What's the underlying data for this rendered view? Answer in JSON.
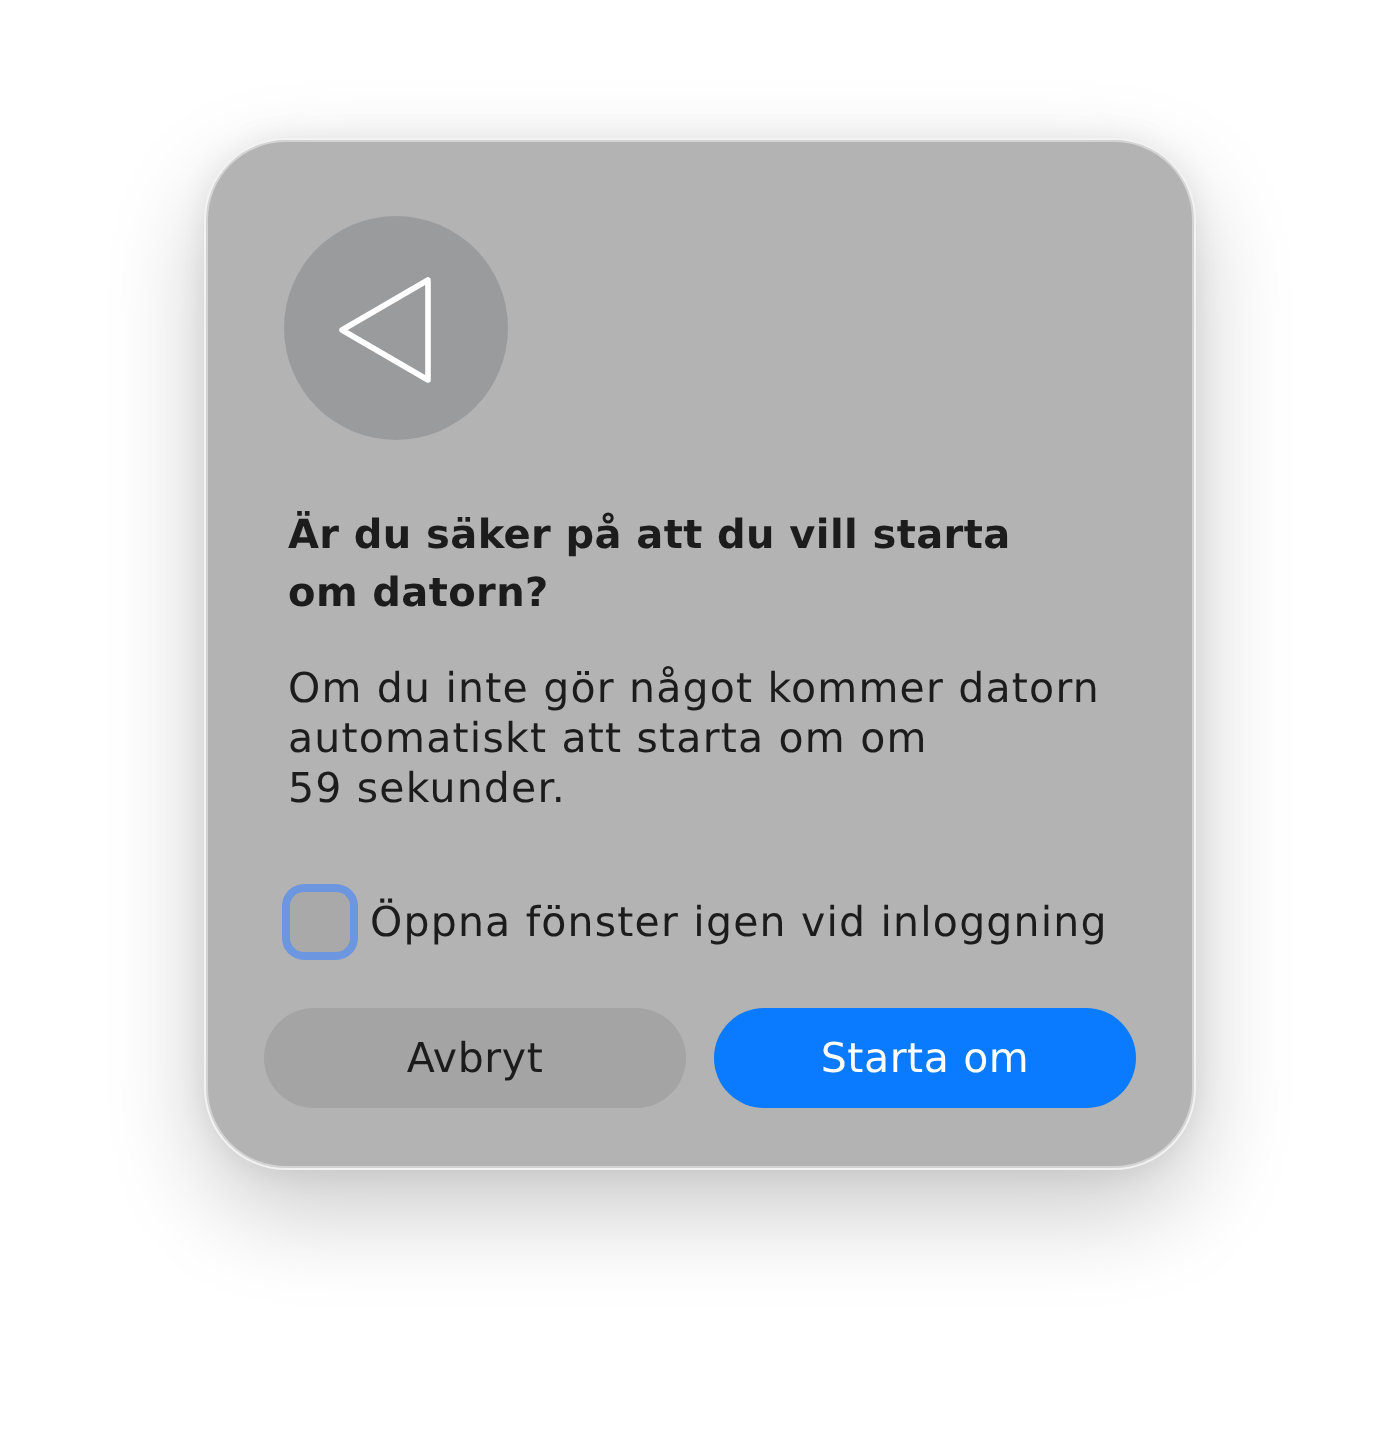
{
  "dialog": {
    "title": "Är du säker på att du vill starta om datorn?",
    "message": "Om du inte gör något kommer datorn automatiskt att starta om om 59 sekunder.",
    "checkbox": {
      "label": "Öppna fönster igen vid inloggning",
      "checked": false,
      "focused": true
    },
    "buttons": [
      {
        "label": "Avbryt",
        "kind": "secondary"
      },
      {
        "label": "Starta om",
        "kind": "primary"
      }
    ]
  }
}
